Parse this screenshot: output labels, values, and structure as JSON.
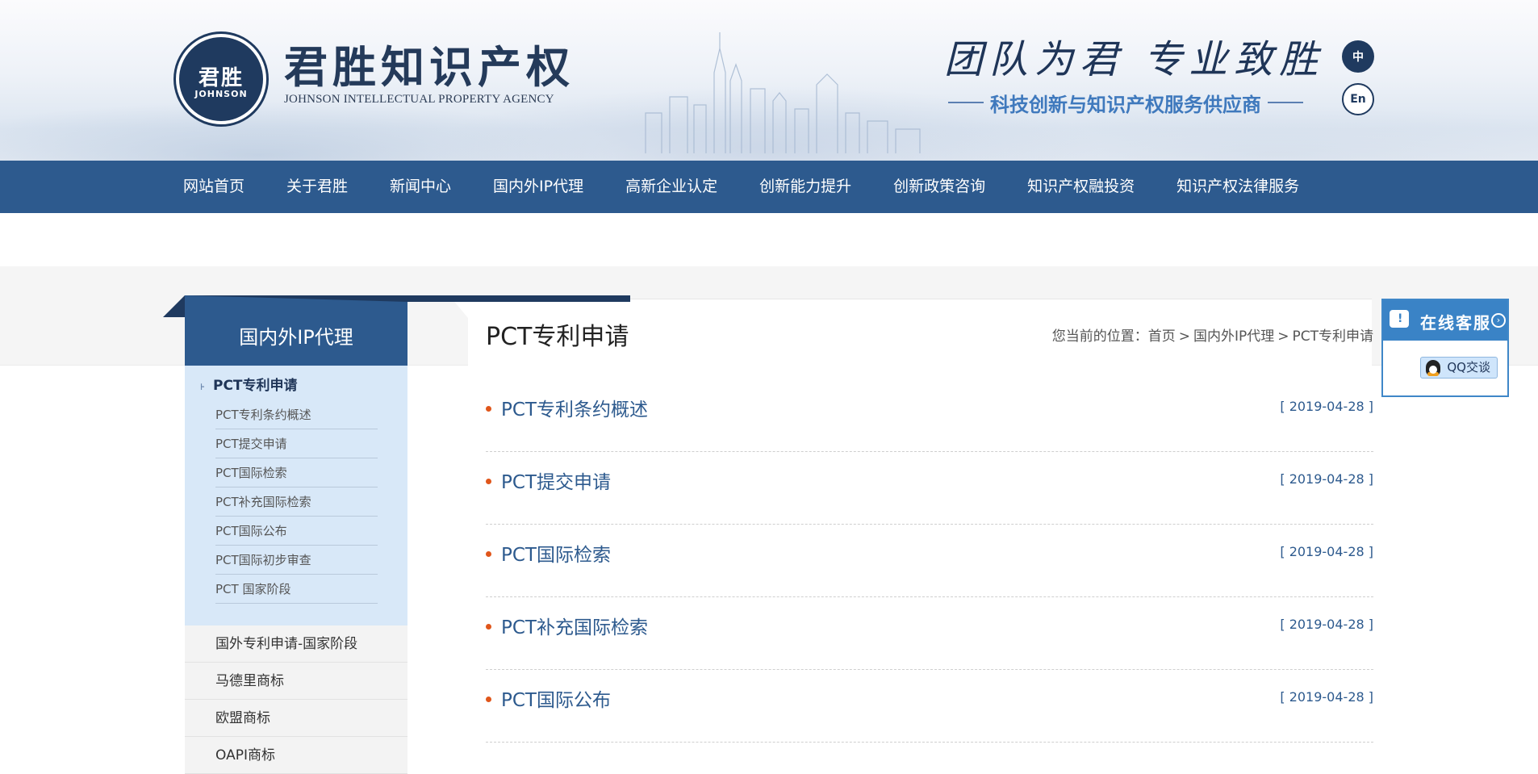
{
  "header": {
    "logo_mark_cn": "君胜",
    "logo_mark_en": "JOHNSON",
    "logo_title": "君胜知识产权",
    "logo_subtitle": "JOHNSON INTELLECTUAL PROPERTY AGENCY",
    "slogan": "团队为君 专业致胜",
    "slogan_sub": "科技创新与知识产权服务供应商",
    "lang_cn": "中",
    "lang_en": "En"
  },
  "nav": {
    "items": [
      "网站首页",
      "关于君胜",
      "新闻中心",
      "国内外IP代理",
      "高新企业认定",
      "创新能力提升",
      "创新政策咨询",
      "知识产权融投资",
      "知识产权法律服务"
    ]
  },
  "sidebar": {
    "heading": "国内外IP代理",
    "current": "PCT专利申请",
    "sub_items": [
      "PCT专利条约概述",
      "PCT提交申请",
      "PCT国际检索",
      "PCT补充国际检索",
      "PCT国际公布",
      "PCT国际初步审查",
      "PCT 国家阶段"
    ],
    "other_items": [
      "国外专利申请-国家阶段",
      "马德里商标",
      "欧盟商标",
      "OAPI商标"
    ]
  },
  "main": {
    "title": "PCT专利申请",
    "breadcrumb": {
      "prefix": "您当前的位置：",
      "items": [
        "首页",
        "国内外IP代理",
        "PCT专利申请"
      ],
      "separator": ">"
    },
    "articles": [
      {
        "title": "PCT专利条约概述",
        "date": "[ 2019-04-28 ]"
      },
      {
        "title": "PCT提交申请",
        "date": "[ 2019-04-28 ]"
      },
      {
        "title": "PCT国际检索",
        "date": "[ 2019-04-28 ]"
      },
      {
        "title": "PCT补充国际检索",
        "date": "[ 2019-04-28 ]"
      },
      {
        "title": "PCT国际公布",
        "date": "[ 2019-04-28 ]"
      }
    ]
  },
  "service": {
    "label": "在线客服",
    "qq_label": "QQ交谈"
  },
  "colors": {
    "nav_bg": "#2d5a8e",
    "sidebar_active_bg": "#d8e8f8",
    "bullet": "#e0561b",
    "service_blue": "#3a83c6"
  }
}
